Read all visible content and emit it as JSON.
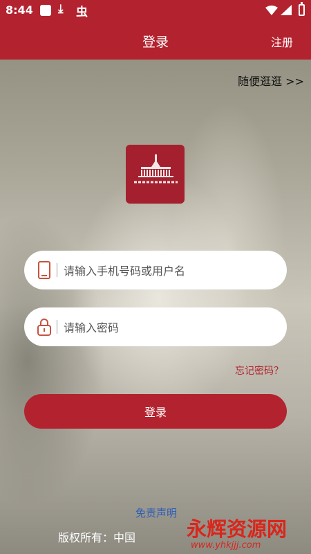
{
  "status_bar": {
    "time": "8:44"
  },
  "header": {
    "title": "登录",
    "register_label": "注册"
  },
  "browse_link": "随便逛逛 >>",
  "form": {
    "username_placeholder": "请输入手机号码或用户名",
    "password_placeholder": "请输入密码",
    "forgot_label": "忘记密码？",
    "login_label": "登录"
  },
  "footer": {
    "disclaimer": "免责声明",
    "copyright": "版权所有：中国"
  },
  "watermark": {
    "text": "永辉资源网",
    "url": "www.yhkjjj.com"
  },
  "colors": {
    "brand": "#b3232f",
    "link_blue": "#2e5fb8"
  }
}
